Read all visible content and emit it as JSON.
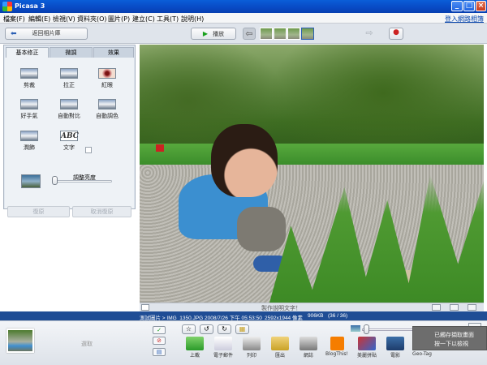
{
  "window": {
    "title": "Picasa 3",
    "min": "_",
    "max": "□",
    "close": "×"
  },
  "menu": {
    "items": [
      "檔案(F)",
      "編輯(E)",
      "檢視(V)",
      "資料夾(O)",
      "圖片(P)",
      "建立(C)",
      "工具(T)",
      "說明(H)"
    ],
    "web_link": "登入網路相簿"
  },
  "toolbar": {
    "back_label": "返回相片庫",
    "back_icon": "arrow-left-icon",
    "play_label": "播放",
    "play_icon": "play-icon",
    "prev_icon": "arrow-left-icon",
    "next_icon": "arrow-right-icon",
    "redeye_icon": "red-eye-tool-icon"
  },
  "edit_panel": {
    "tabs": [
      "基本修正",
      "微調",
      "效果"
    ],
    "active_tab": 0,
    "tools": [
      "剪裁",
      "拉正",
      "紅眼",
      "好手氣",
      "自動對比",
      "自動調色",
      "潤飾",
      "文字"
    ],
    "text_icon": "ABC",
    "brightness_label": "調整亮度",
    "brightness_value": 0,
    "undo_label": "復原",
    "redo_label": "取消復原"
  },
  "caption": {
    "placeholder": "製作說明文字！"
  },
  "status": {
    "path": "測試圖片 > IMG_1350.JPG",
    "date": "2008/7/26 下午 05:53:50",
    "dimensions": "2592x1944 像素",
    "size": "906KB",
    "index": "(36 / 36)"
  },
  "tray": {
    "label": "選取",
    "actions": [
      "上載",
      "電子郵件",
      "列印",
      "匯出",
      "網誌",
      "BlogThis!",
      "美麗拼貼",
      "電影",
      "Geo-Tag"
    ]
  },
  "geotag_tooltip": {
    "line1": "已觸存擷取畫面",
    "line2": "按一下以檢視"
  },
  "colors": {
    "title_bar": "#0a5ed8",
    "status_bar": "#1f4d95",
    "accent_green": "#19a11d"
  }
}
